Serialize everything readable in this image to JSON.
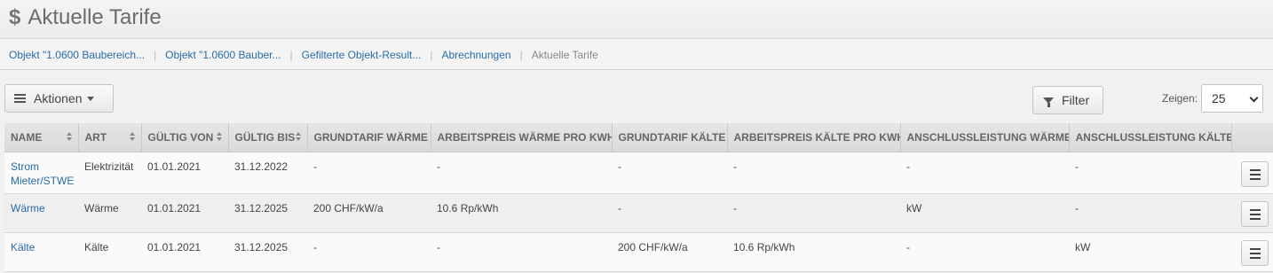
{
  "header": {
    "title": "Aktuelle Tarife",
    "icon": "dollar-icon"
  },
  "breadcrumb": [
    "Objekt \"1.0600 Baubereich...",
    "Objekt \"1.0600 Bauber...",
    "Gefilterte Objekt-Result...",
    "Abrechnungen",
    "Aktuelle Tarife"
  ],
  "toolbar": {
    "actions_label": "Aktionen",
    "filter_label": "Filter",
    "show_label": "Zeigen:",
    "page_size": "25"
  },
  "table": {
    "columns": [
      "Name",
      "Art",
      "Gültig von",
      "Gültig bis",
      "Grundtarif Wärme",
      "Arbeitspreis Wärme pro kWh",
      "Grundtarif Kälte",
      "Arbeitspreis Kälte pro kWh",
      "Anschlussleistung Wärme",
      "Anschlussleistung Kälte"
    ],
    "rows": [
      [
        "Strom Mieter/STWE",
        "Elektrizität",
        "01.01.2021",
        "31.12.2022",
        "-",
        "-",
        "-",
        "-",
        "-",
        "-"
      ],
      [
        "Wärme",
        "Wärme",
        "01.01.2021",
        "31.12.2025",
        "200 CHF/kW/a",
        "10.6 Rp/kWh",
        "-",
        "-",
        "kW",
        "-"
      ],
      [
        "Kälte",
        "Kälte",
        "01.01.2021",
        "31.12.2025",
        "-",
        "-",
        "200 CHF/kW/a",
        "10.6 Rp/kWh",
        "-",
        "kW"
      ]
    ]
  },
  "colors": {
    "link": "#2a6ba8",
    "header_bg": "#dedede"
  }
}
